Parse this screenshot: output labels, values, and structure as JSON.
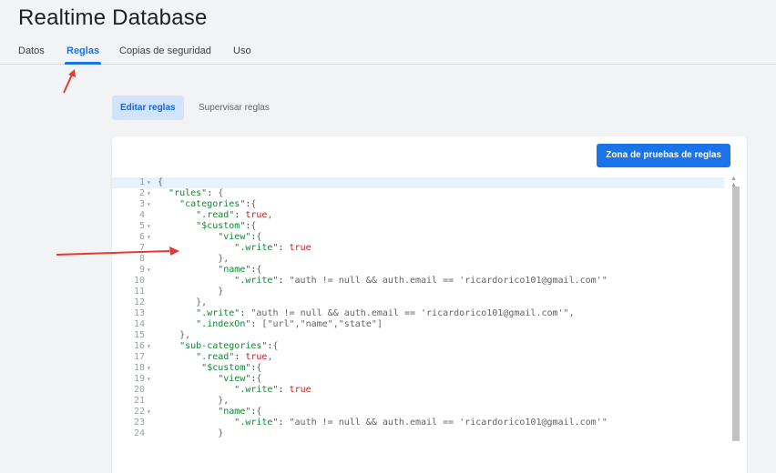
{
  "header": {
    "title": "Realtime Database"
  },
  "tabs": [
    {
      "label": "Datos"
    },
    {
      "label": "Reglas"
    },
    {
      "label": "Copias de seguridad"
    },
    {
      "label": "Uso"
    }
  ],
  "subtabs": [
    {
      "label": "Editar reglas"
    },
    {
      "label": "Supervisar reglas"
    }
  ],
  "editor": {
    "sandbox_button": "Zona de pruebas de reglas",
    "line_numbers": [
      "1",
      "2",
      "3",
      "4",
      "5",
      "6",
      "7",
      "8",
      "9",
      "10",
      "11",
      "12",
      "13",
      "14",
      "15",
      "16",
      "17",
      "18",
      "19",
      "20",
      "21",
      "22",
      "23",
      "24"
    ],
    "lines": [
      "{",
      "  \"rules\": {",
      "    \"categories\":{",
      "       \".read\": true,",
      "       \"$custom\":{",
      "           \"view\":{",
      "              \".write\": true",
      "           },",
      "           \"name\":{",
      "              \".write\": \"auth != null && auth.email == 'ricardorico101@gmail.com'\"",
      "           }",
      "       },",
      "       \".write\": \"auth != null && auth.email == 'ricardorico101@gmail.com'\",",
      "       \".indexOn\": [\"url\",\"name\",\"state\"]",
      "    },",
      "    \"sub-categories\":{",
      "       \".read\": true,",
      "        \"$custom\":{",
      "           \"view\":{",
      "              \".write\": true",
      "           },",
      "           \"name\":{",
      "              \".write\": \"auth != null && auth.email == 'ricardorico101@gmail.com'\"",
      "           }"
    ],
    "foldable_lines": [
      1,
      2,
      3,
      5,
      6,
      9,
      16,
      18,
      19,
      22
    ]
  },
  "colors": {
    "accent": "#1a73e8",
    "annotation_arrow": "#e53935"
  }
}
